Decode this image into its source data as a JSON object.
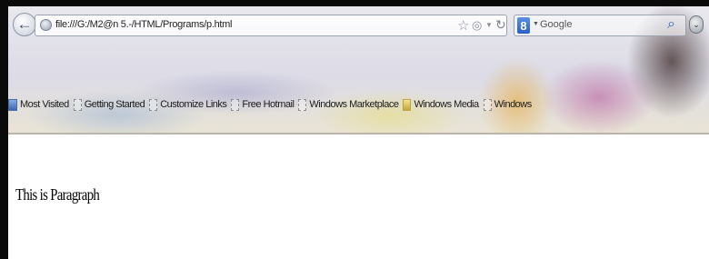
{
  "address_bar": {
    "url": "file:///G:/M2@n 5.-/HTML/Programs/p.html"
  },
  "search_bar": {
    "placeholder": "Google",
    "engine_glyph": "8"
  },
  "bookmarks": [
    {
      "label": "Most Visited",
      "icon": "most-visited-icon"
    },
    {
      "label": "Getting Started",
      "icon": "page-icon"
    },
    {
      "label": "Customize Links",
      "icon": "page-icon"
    },
    {
      "label": "Free Hotmail",
      "icon": "page-icon"
    },
    {
      "label": "Windows Marketplace",
      "icon": "page-icon"
    },
    {
      "label": "Windows Media",
      "icon": "windows-media-icon"
    },
    {
      "label": "Windows",
      "icon": "page-icon"
    }
  ],
  "page": {
    "paragraph": "This is Paragraph"
  },
  "colors": {
    "frame": "#0a0a0a",
    "search_accent": "#2f64b8"
  }
}
